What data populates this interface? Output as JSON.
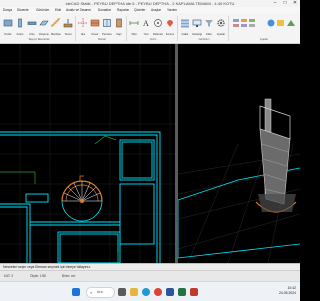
{
  "window": {
    "title": "ideCAD Statik - PEYBU DEPTHA ide.5 - PEYBU DEPTHA - 2 KAPLAMA TEMAMI - 4.40 KOTU",
    "min_glyph": "–",
    "max_glyph": "□",
    "close_glyph": "✕"
  },
  "menu": [
    "Dosya",
    "Düzenle",
    "Görünüm",
    "Ekle",
    "Analiz ve Tasarım",
    "Donatılar",
    "Raporlar",
    "Çizimler",
    "Araçlar",
    "Yardım"
  ],
  "ribbon": {
    "tools": [
      {
        "label": "Perde",
        "icon": "wall-tool-icon"
      },
      {
        "label": "Kolon",
        "icon": "column-tool-icon"
      },
      {
        "label": "Kiriş",
        "icon": "beam-tool-icon"
      },
      {
        "label": "Döşeme",
        "icon": "slab-tool-icon"
      },
      {
        "label": "Merdiven",
        "icon": "stair-tool-icon"
      },
      {
        "label": "Temel",
        "icon": "foundation-tool-icon"
      },
      {
        "label": "Aks",
        "icon": "axis-tool-icon"
      },
      {
        "label": "Duvar",
        "icon": "masonry-tool-icon"
      },
      {
        "label": "Pencere",
        "icon": "window-tool-icon"
      },
      {
        "label": "Kapı",
        "icon": "door-tool-icon"
      },
      {
        "label": "Ölçü",
        "icon": "dimension-tool-icon"
      },
      {
        "label": "Yazı",
        "icon": "text-tool-icon"
      },
      {
        "label": "Referans",
        "icon": "reference-tool-icon"
      },
      {
        "label": "Konum",
        "icon": "location-tool-icon"
      },
      {
        "label": "Katlar",
        "icon": "floors-tool-icon"
      },
      {
        "label": "Gösterge",
        "icon": "display-tool-icon"
      },
      {
        "label": "Filtre",
        "icon": "filter-tool-icon"
      },
      {
        "label": "Ayarlar",
        "icon": "settings-tool-icon"
      }
    ],
    "groups": [
      "Taşıyıcı Elemanlar",
      "Mimari",
      "Çizim",
      "Görünüm",
      "Ayarlar"
    ]
  },
  "command": {
    "prompt": "Nesneleri seçin veya Eleman seçmek için fareye tıklayınız."
  },
  "status": {
    "items": [
      "KAT: 2",
      "Ölçek: 1/50",
      "Birim: cm"
    ]
  },
  "taskbar": {
    "search_placeholder": "Ara",
    "time": "10:42",
    "date": "24.05.2024",
    "apps": [
      {
        "name": "start-icon",
        "color": "#1e73d8"
      },
      {
        "name": "taskview-icon",
        "color": "#5a5a5a"
      },
      {
        "name": "explorer-icon",
        "color": "#e8b53a"
      },
      {
        "name": "edge-icon",
        "color": "#1f9ad6"
      },
      {
        "name": "chrome-icon",
        "color": "#db4437"
      },
      {
        "name": "word-icon",
        "color": "#2b579a"
      },
      {
        "name": "excel-icon",
        "color": "#217346"
      },
      {
        "name": "idecad-icon",
        "color": "#c0392b"
      }
    ]
  },
  "colors": {
    "plan_lines": "#00e5ff",
    "dimension_lines": "#25a040",
    "highlight": "#e07b1f",
    "viewport_bg": "#000000"
  }
}
